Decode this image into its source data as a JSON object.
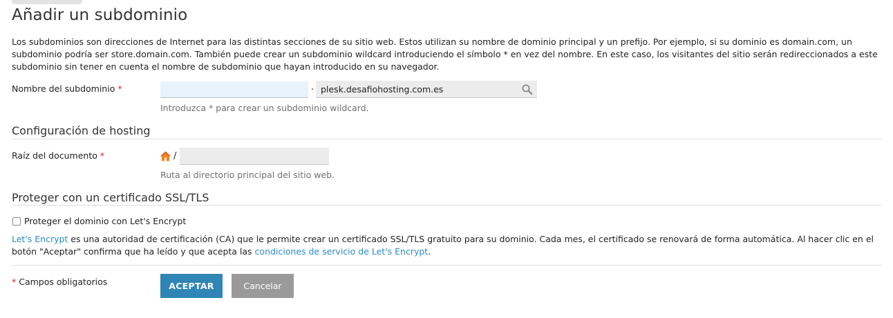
{
  "page": {
    "title": "Añadir un subdominio",
    "intro": "Los subdominios son direcciones de Internet para las distintas secciones de su sitio web. Estos utilizan su nombre de dominio principal y un prefijo. Por ejemplo, si su dominio es domain.com, un subdominio podría ser store.domain.com. También puede crear un subdominio wildcard introduciendo el símbolo * en vez del nombre. En este caso, los visitantes del sitio serán redireccionados a este subdominio sin tener en cuenta el nombre de subdominio que hayan introducido en su navegador."
  },
  "subdomain": {
    "label": "Nombre del subdominio",
    "required_mark": "*",
    "value": "",
    "separator": ".",
    "domain": "plesk.desafiohosting.com.es",
    "hint": "Introduzca * para crear un subdominio wildcard."
  },
  "hosting": {
    "section_title": "Configuración de hosting",
    "docroot_label": "Raíz del documento",
    "required_mark": "*",
    "path_prefix": "/",
    "docroot_value": "",
    "hint": "Ruta al directorio principal del sitio web."
  },
  "ssl": {
    "section_title": "Proteger con un certificado SSL/TLS",
    "checkbox_label": "Proteger el dominio con Let's Encrypt",
    "checked": false,
    "link_letsencrypt": "Let's Encrypt",
    "text_middle": " es una autoridad de certificación (CA) que le permite crear un certificado SSL/TLS gratuito para su dominio. Cada mes, el certificado se renovará de forma automática. Al hacer clic en el botón \"Aceptar\" confirma que ha leído y que acepta las ",
    "link_terms": "condiciones de servicio de Let's Encrypt",
    "text_end": "."
  },
  "footer": {
    "required_mark": "*",
    "required_note": " Campos obligatorios",
    "accept_label": "ACEPTAR",
    "cancel_label": "Cancelar"
  },
  "colors": {
    "primary": "#2f86b6",
    "link": "#2a8bc5",
    "required": "#d7262b",
    "secondary_button": "#9a9a9a",
    "home_icon": "#f0821e"
  },
  "icons": {
    "domain_picker": "search-icon",
    "docroot": "home-icon"
  }
}
